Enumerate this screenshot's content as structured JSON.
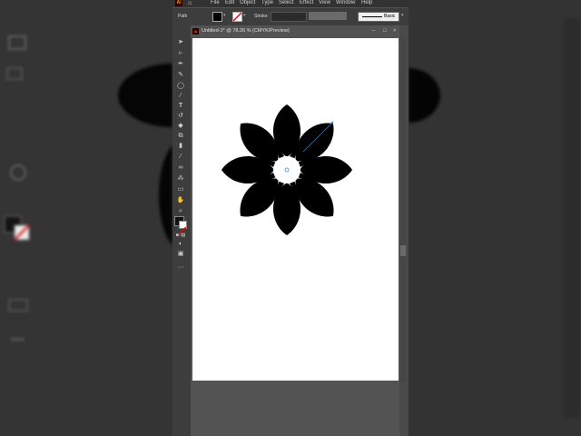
{
  "menu": {
    "app_logo": "Ai",
    "items": [
      "File",
      "Edit",
      "Object",
      "Type",
      "Select",
      "Effect",
      "View",
      "Window",
      "Help"
    ]
  },
  "control_bar": {
    "selection_type": "Path",
    "stroke_label": "Stroke:",
    "style_label": "Basic"
  },
  "document": {
    "tab_title": "Untitled-1* @ 78.26 % (CMYK/Preview)",
    "tab_buttons": [
      "–",
      "□",
      "×"
    ]
  },
  "colors": {
    "ui_dark": "#323232",
    "panel": "#3d3d3d",
    "canvas_bg": "#535353",
    "artboard": "#ffffff",
    "flower": "#000000",
    "logo_bg": "#330000",
    "logo_text": "#ff9a00"
  },
  "icons": {
    "toolbar": [
      "selection-tool-icon",
      "direct-selection-tool-icon",
      "pen-tool-icon",
      "curvature-tool-icon",
      "ellipse-tool-icon",
      "paintbrush-tool-icon",
      "type-tool-icon",
      "rotate-tool-icon",
      "eraser-tool-icon",
      "scale-tool-icon",
      "gradient-tool-icon",
      "eyedropper-tool-icon",
      "blend-tool-icon",
      "symbol-sprayer-tool-icon",
      "artboard-tool-icon",
      "hand-tool-icon",
      "zoom-tool-icon",
      "fill-stroke-swatch-icon",
      "draw-mode-icon",
      "screen-mode-icon",
      "more-tools-icon"
    ]
  }
}
